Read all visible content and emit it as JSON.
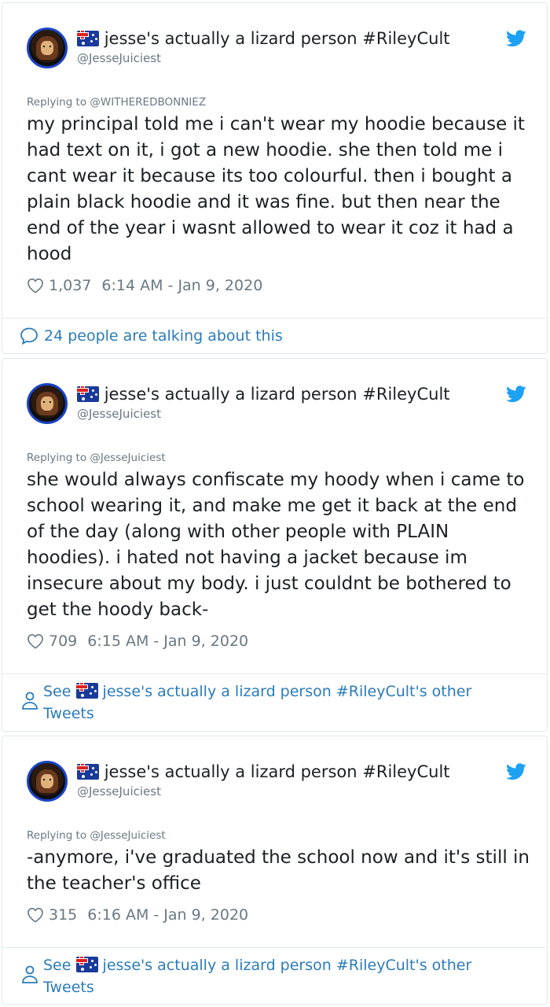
{
  "tweets": [
    {
      "name": "jesse's actually a lizard person #RileyCult",
      "handle": "@JesseJuiciest",
      "replying_to": "Replying to @WITHEREDBONNIEZ",
      "text": "my principal told me i can't wear my hoodie because it had text on it, i got a new hoodie. she then told me i cant wear it because its too colourful. then i bought a plain black hoodie and it was fine. but then near the end of the year i wasnt allowed to wear it coz it had a hood",
      "likes": "1,037",
      "timestamp": "6:14 AM - Jan 9, 2020",
      "footer": "24 people are talking about this"
    },
    {
      "name": "jesse's actually a lizard person #RileyCult",
      "handle": "@JesseJuiciest",
      "replying_to": "Replying to @JesseJuiciest",
      "text": "she would always confiscate my hoody when i came to school wearing it, and make me get it back at the end of the day (along with other people with PLAIN hoodies). i hated not having a jacket because im insecure about my body. i just couldnt be bothered to get the hoody back-",
      "likes": "709",
      "timestamp": "6:15 AM - Jan 9, 2020",
      "footer_see": "See",
      "footer_name": "jesse's actually a lizard person #RileyCult's other Tweets"
    },
    {
      "name": "jesse's actually a lizard person #RileyCult",
      "handle": "@JesseJuiciest",
      "replying_to": "Replying to @JesseJuiciest",
      "text": "-anymore, i've graduated the school now and it's still in the teacher's office",
      "likes": "315",
      "timestamp": "6:16 AM - Jan 9, 2020",
      "footer_see": "See",
      "footer_name": "jesse's actually a lizard person #RileyCult's other Tweets"
    }
  ],
  "icons": {
    "heart": "heart-icon",
    "bird": "twitter-bird-icon",
    "bubble": "speech-bubble-icon",
    "person": "person-icon",
    "flag": "australia-flag-icon"
  },
  "colors": {
    "link": "#2b7bb9",
    "twitter_blue": "#1da1f2",
    "muted": "#697882",
    "text": "#1c2022"
  }
}
